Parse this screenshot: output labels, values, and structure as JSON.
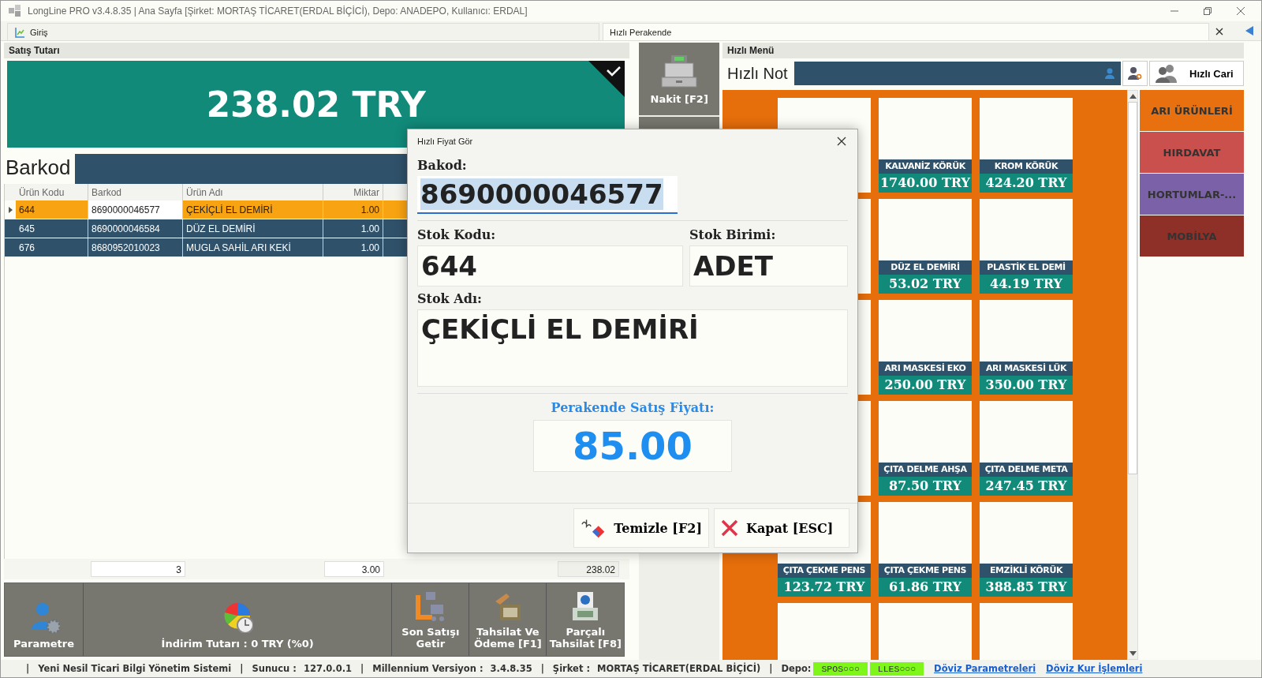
{
  "window": {
    "title": "LongLine PRO v3.4.8.35 | Ana Sayfa [Şirket: MORTAŞ TİCARET(ERDAL BİÇİCİ), Depo: ANADEPO, Kullanıcı: ERDAL]"
  },
  "tabs": [
    {
      "label": "Giriş",
      "selected": false
    },
    {
      "label": "Hızlı Perakende",
      "selected": true
    }
  ],
  "sales_total": {
    "header": "Satış Tutarı",
    "amount": "238.02 TRY"
  },
  "barcode": {
    "label": "Barkod"
  },
  "table": {
    "columns": [
      "Ürün Kodu",
      "Barkod",
      "Ürün Adı",
      "Miktar"
    ],
    "rows": [
      {
        "cells": [
          "644",
          "8690000046577",
          "ÇEKİÇLİ EL DEMİRİ",
          "1.00"
        ],
        "selected": true
      },
      {
        "cells": [
          "645",
          "8690000046584",
          "DÜZ EL DEMİRİ",
          "1.00"
        ],
        "selected": false
      },
      {
        "cells": [
          "676",
          "8680952010023",
          "MUGLA SAHİL ARI KEKİ",
          "1.00"
        ],
        "selected": false
      }
    ],
    "footer": [
      "3",
      "3.00",
      "238.02"
    ]
  },
  "bottom_buttons": [
    {
      "kind": "params",
      "label": "Parametre"
    },
    {
      "kind": "discount",
      "label": "İndirim Tutarı : 0 TRY (%0)"
    },
    {
      "kind": "last",
      "label": "Son Satışı Getir"
    },
    {
      "kind": "pay",
      "label": "Tahsilat Ve Ödeme [F1]"
    },
    {
      "kind": "split",
      "label": "Parçalı Tahsilat [F8]"
    }
  ],
  "cash_button": {
    "label": "Nakit [F2]"
  },
  "quick_menu": {
    "header": "Hızlı Menü",
    "note_label": "Hızlı Not",
    "customer_button": "Hızlı Cari",
    "tiles": [
      {
        "kind": "blank"
      },
      {
        "kind": "product",
        "name": "KALVANİZ KÖRÜK",
        "price": "1740.00 TRY"
      },
      {
        "kind": "product",
        "name": "KROM KÖRÜK",
        "price": "424.20 TRY"
      },
      {
        "kind": "blank"
      },
      {
        "kind": "product",
        "name": "DÜZ EL DEMİRİ",
        "price": "53.02 TRY"
      },
      {
        "kind": "product",
        "name": "PLASTİK EL DEMİ",
        "price": "44.19 TRY"
      },
      {
        "kind": "blank"
      },
      {
        "kind": "product",
        "name": "ARI MASKESİ EKO",
        "price": "250.00 TRY"
      },
      {
        "kind": "product",
        "name": "ARI MASKESİ LÜK",
        "price": "350.00 TRY"
      },
      {
        "kind": "blank"
      },
      {
        "kind": "product",
        "name": "ÇITA DELME AHŞA",
        "price": "87.50 TRY"
      },
      {
        "kind": "product",
        "name": "ÇITA DELME META",
        "price": "247.45 TRY"
      },
      {
        "kind": "product",
        "name": "ÇITA ÇEKME PENS",
        "price": "123.72 TRY"
      },
      {
        "kind": "product",
        "name": "ÇITA ÇEKME PENS",
        "price": "61.86 TRY"
      },
      {
        "kind": "product",
        "name": "EMZİKLİ KÖRÜK",
        "price": "388.85 TRY"
      },
      {
        "kind": "blank"
      },
      {
        "kind": "blank"
      },
      {
        "kind": "blank"
      }
    ],
    "categories": [
      {
        "label": "ARI ÜRÜNLERİ",
        "color": "#e8700e"
      },
      {
        "label": "HIRDAVAT",
        "color": "#c9504d"
      },
      {
        "label": "HORTUMLAR-...",
        "color": "#7b62a8"
      },
      {
        "label": "MOBİLYA",
        "color": "#8e3028"
      }
    ]
  },
  "dialog": {
    "title": "Hızlı Fiyat Gör",
    "barcode_label": "Bakod:",
    "barcode": "8690000046577",
    "code_label": "Stok Kodu:",
    "code": "644",
    "unit_label": "Stok Birimi:",
    "unit": "ADET",
    "name_label": "Stok Adı:",
    "name": "ÇEKİÇLİ EL DEMİRİ",
    "price_label": "Perakende Satış Fiyatı:",
    "price": "85.00",
    "buttons": [
      {
        "kind": "clear",
        "label": "Temizle [F2]"
      },
      {
        "kind": "close",
        "label": "Kapat [ESC]"
      }
    ]
  },
  "status_bar": [
    {
      "kind": "sep",
      "text": "|"
    },
    {
      "kind": "text",
      "text": "Yeni Nesil Ticari Bilgi Yönetim Sistemi"
    },
    {
      "kind": "sep",
      "text": "|"
    },
    {
      "kind": "text",
      "text": "Sunucu :"
    },
    {
      "kind": "text",
      "text": "127.0.0.1"
    },
    {
      "kind": "sep",
      "text": "|"
    },
    {
      "kind": "text",
      "text": "Millennium Versiyon :"
    },
    {
      "kind": "text",
      "text": "3.4.8.35"
    },
    {
      "kind": "sep",
      "text": "|"
    },
    {
      "kind": "text",
      "text": "Şirket :"
    },
    {
      "kind": "text",
      "text": "MORTAŞ TİCARET(ERDAL BİÇİCİ)"
    },
    {
      "kind": "sep",
      "text": "|"
    },
    {
      "kind": "text",
      "text": "Depo:"
    },
    {
      "kind": "badge",
      "text": "SPOS○○○"
    },
    {
      "kind": "badge",
      "text": "LLES○○○"
    },
    {
      "kind": "link",
      "text": "Döviz Parametreleri"
    },
    {
      "kind": "link",
      "text": "Döviz Kur İşlemleri"
    }
  ]
}
